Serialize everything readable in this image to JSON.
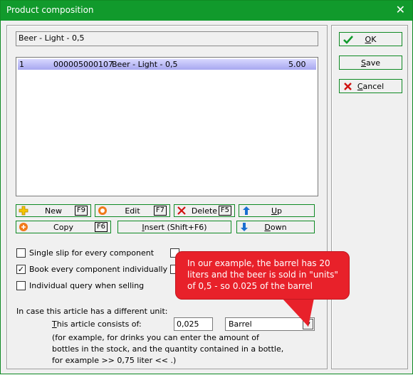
{
  "window": {
    "title": "Product composition",
    "close_glyph": "✕"
  },
  "article_name": "Beer - Light - 0,5",
  "components": [
    {
      "pos": "1",
      "number": "000005000107",
      "name": "Beer - Light - 0,5",
      "qty": "5.00"
    }
  ],
  "buttons": {
    "new": {
      "label": "New",
      "key": "F9"
    },
    "edit": {
      "label": "Edit",
      "key": "F7"
    },
    "delete": {
      "label": "Delete",
      "key": "F5"
    },
    "up": {
      "label": "Up"
    },
    "copy": {
      "label": "Copy",
      "key": "F6"
    },
    "insert": {
      "label": "Insert (Shift+F6)"
    },
    "down": {
      "label": "Down"
    }
  },
  "dialog_buttons": {
    "ok": "OK",
    "save": "Save",
    "cancel": "Cancel"
  },
  "options": {
    "single_slip": {
      "label": "Single slip for every component",
      "checked": false
    },
    "book_individually": {
      "label": "Book every component individually",
      "checked": true
    },
    "individual_query": {
      "label": "Individual query when selling",
      "checked": false
    }
  },
  "callout": "In our example, the barrel has 20 liters and the beer is sold in \"units\" of 0,5 - so 0.025 of the barrel",
  "unit": {
    "heading": "In case this article has a different unit:",
    "consists_label": "This article consists of:",
    "amount": "0,025",
    "unit_value": "Barrel",
    "hint_line1": "(for example, for drinks you can enter the amount of",
    "hint_line2": "bottles in the stock, and the quantity contained in a bottle,",
    "hint_line3": "for example >> 0,75 liter << .)"
  },
  "colors": {
    "title_bar": "#119a2c",
    "callout": "#e8212a",
    "selection": "#b0b0f4"
  }
}
